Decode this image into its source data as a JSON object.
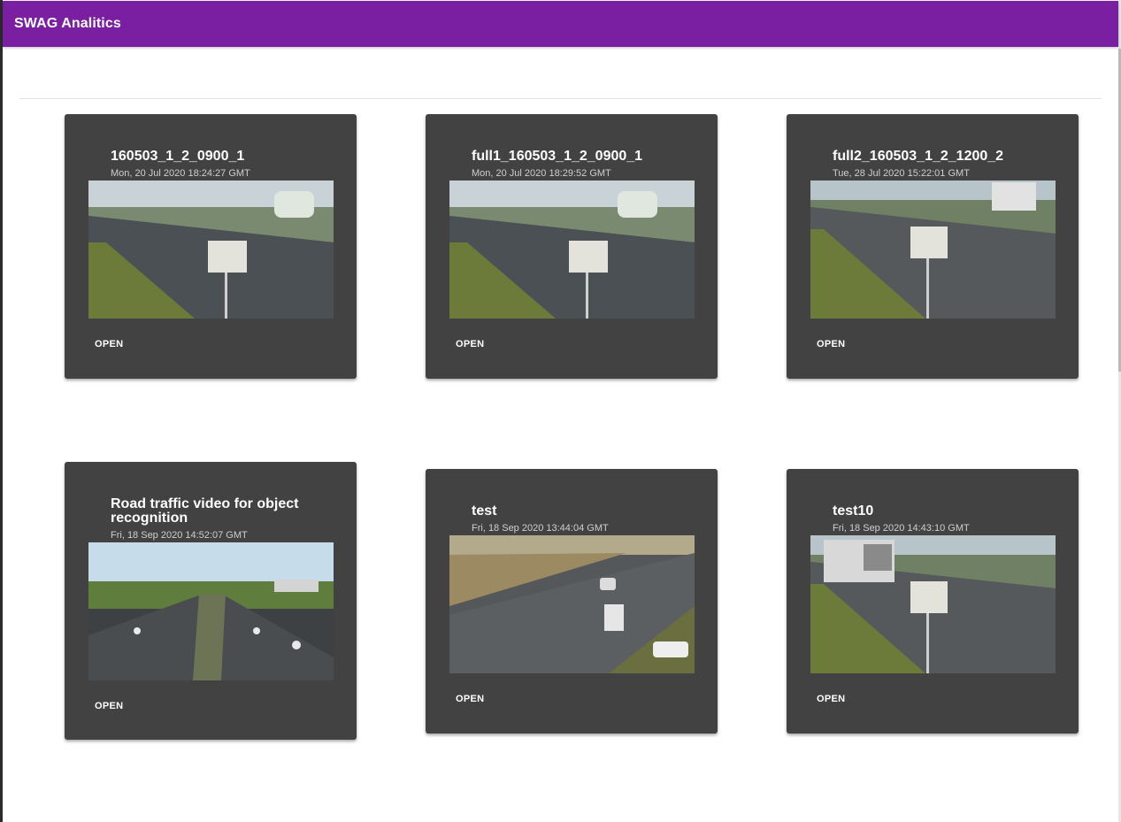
{
  "app": {
    "title": "SWAG Analitics"
  },
  "cards": [
    {
      "title": "160503_1_2_0900_1",
      "date": "Mon, 20 Jul 2020 18:24:27 GMT",
      "action": "OPEN"
    },
    {
      "title": "full1_160503_1_2_0900_1",
      "date": "Mon, 20 Jul 2020 18:29:52 GMT",
      "action": "OPEN"
    },
    {
      "title": "full2_160503_1_2_1200_2",
      "date": "Tue, 28 Jul 2020 15:22:01 GMT",
      "action": "OPEN"
    },
    {
      "title": "Road traffic video for object recognition",
      "date": "Fri, 18 Sep 2020 14:52:07 GMT",
      "action": "OPEN"
    },
    {
      "title": "test",
      "date": "Fri, 18 Sep 2020 13:44:04 GMT",
      "action": "OPEN"
    },
    {
      "title": "test10",
      "date": "Fri, 18 Sep 2020 14:43:10 GMT",
      "action": "OPEN"
    }
  ]
}
